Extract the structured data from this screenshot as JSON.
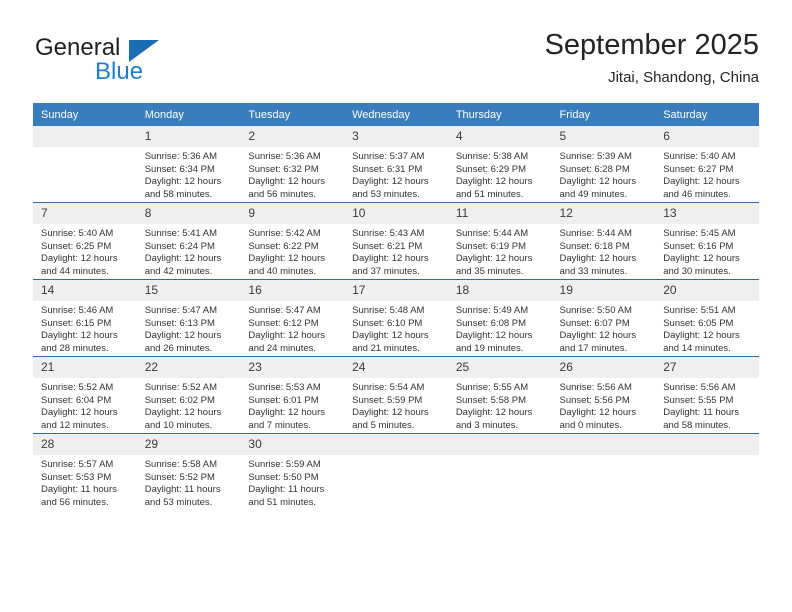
{
  "brand": {
    "name_top": "General",
    "name_bottom": "Blue",
    "triangle_icon": "triangle-icon",
    "color_black": "#231f20",
    "color_blue": "#1b7fd4"
  },
  "header": {
    "title": "September 2025",
    "subtitle": "Jitai, Shandong, China"
  },
  "theme": {
    "header_bg": "#3a7dbf",
    "row_divider": "#2e6da4",
    "daynum_bg": "#efefef",
    "text": "#333333"
  },
  "weekdays": [
    "Sunday",
    "Monday",
    "Tuesday",
    "Wednesday",
    "Thursday",
    "Friday",
    "Saturday"
  ],
  "labels": {
    "sunrise": "Sunrise:",
    "sunset": "Sunset:",
    "daylight": "Daylight:"
  },
  "weeks": [
    [
      {
        "day": "",
        "sunrise": "",
        "sunset": "",
        "daylight_line1": "",
        "daylight_line2": ""
      },
      {
        "day": "1",
        "sunrise": "Sunrise: 5:36 AM",
        "sunset": "Sunset: 6:34 PM",
        "daylight_line1": "Daylight: 12 hours",
        "daylight_line2": "and 58 minutes."
      },
      {
        "day": "2",
        "sunrise": "Sunrise: 5:36 AM",
        "sunset": "Sunset: 6:32 PM",
        "daylight_line1": "Daylight: 12 hours",
        "daylight_line2": "and 56 minutes."
      },
      {
        "day": "3",
        "sunrise": "Sunrise: 5:37 AM",
        "sunset": "Sunset: 6:31 PM",
        "daylight_line1": "Daylight: 12 hours",
        "daylight_line2": "and 53 minutes."
      },
      {
        "day": "4",
        "sunrise": "Sunrise: 5:38 AM",
        "sunset": "Sunset: 6:29 PM",
        "daylight_line1": "Daylight: 12 hours",
        "daylight_line2": "and 51 minutes."
      },
      {
        "day": "5",
        "sunrise": "Sunrise: 5:39 AM",
        "sunset": "Sunset: 6:28 PM",
        "daylight_line1": "Daylight: 12 hours",
        "daylight_line2": "and 49 minutes."
      },
      {
        "day": "6",
        "sunrise": "Sunrise: 5:40 AM",
        "sunset": "Sunset: 6:27 PM",
        "daylight_line1": "Daylight: 12 hours",
        "daylight_line2": "and 46 minutes."
      }
    ],
    [
      {
        "day": "7",
        "sunrise": "Sunrise: 5:40 AM",
        "sunset": "Sunset: 6:25 PM",
        "daylight_line1": "Daylight: 12 hours",
        "daylight_line2": "and 44 minutes."
      },
      {
        "day": "8",
        "sunrise": "Sunrise: 5:41 AM",
        "sunset": "Sunset: 6:24 PM",
        "daylight_line1": "Daylight: 12 hours",
        "daylight_line2": "and 42 minutes."
      },
      {
        "day": "9",
        "sunrise": "Sunrise: 5:42 AM",
        "sunset": "Sunset: 6:22 PM",
        "daylight_line1": "Daylight: 12 hours",
        "daylight_line2": "and 40 minutes."
      },
      {
        "day": "10",
        "sunrise": "Sunrise: 5:43 AM",
        "sunset": "Sunset: 6:21 PM",
        "daylight_line1": "Daylight: 12 hours",
        "daylight_line2": "and 37 minutes."
      },
      {
        "day": "11",
        "sunrise": "Sunrise: 5:44 AM",
        "sunset": "Sunset: 6:19 PM",
        "daylight_line1": "Daylight: 12 hours",
        "daylight_line2": "and 35 minutes."
      },
      {
        "day": "12",
        "sunrise": "Sunrise: 5:44 AM",
        "sunset": "Sunset: 6:18 PM",
        "daylight_line1": "Daylight: 12 hours",
        "daylight_line2": "and 33 minutes."
      },
      {
        "day": "13",
        "sunrise": "Sunrise: 5:45 AM",
        "sunset": "Sunset: 6:16 PM",
        "daylight_line1": "Daylight: 12 hours",
        "daylight_line2": "and 30 minutes."
      }
    ],
    [
      {
        "day": "14",
        "sunrise": "Sunrise: 5:46 AM",
        "sunset": "Sunset: 6:15 PM",
        "daylight_line1": "Daylight: 12 hours",
        "daylight_line2": "and 28 minutes."
      },
      {
        "day": "15",
        "sunrise": "Sunrise: 5:47 AM",
        "sunset": "Sunset: 6:13 PM",
        "daylight_line1": "Daylight: 12 hours",
        "daylight_line2": "and 26 minutes."
      },
      {
        "day": "16",
        "sunrise": "Sunrise: 5:47 AM",
        "sunset": "Sunset: 6:12 PM",
        "daylight_line1": "Daylight: 12 hours",
        "daylight_line2": "and 24 minutes."
      },
      {
        "day": "17",
        "sunrise": "Sunrise: 5:48 AM",
        "sunset": "Sunset: 6:10 PM",
        "daylight_line1": "Daylight: 12 hours",
        "daylight_line2": "and 21 minutes."
      },
      {
        "day": "18",
        "sunrise": "Sunrise: 5:49 AM",
        "sunset": "Sunset: 6:08 PM",
        "daylight_line1": "Daylight: 12 hours",
        "daylight_line2": "and 19 minutes."
      },
      {
        "day": "19",
        "sunrise": "Sunrise: 5:50 AM",
        "sunset": "Sunset: 6:07 PM",
        "daylight_line1": "Daylight: 12 hours",
        "daylight_line2": "and 17 minutes."
      },
      {
        "day": "20",
        "sunrise": "Sunrise: 5:51 AM",
        "sunset": "Sunset: 6:05 PM",
        "daylight_line1": "Daylight: 12 hours",
        "daylight_line2": "and 14 minutes."
      }
    ],
    [
      {
        "day": "21",
        "sunrise": "Sunrise: 5:52 AM",
        "sunset": "Sunset: 6:04 PM",
        "daylight_line1": "Daylight: 12 hours",
        "daylight_line2": "and 12 minutes."
      },
      {
        "day": "22",
        "sunrise": "Sunrise: 5:52 AM",
        "sunset": "Sunset: 6:02 PM",
        "daylight_line1": "Daylight: 12 hours",
        "daylight_line2": "and 10 minutes."
      },
      {
        "day": "23",
        "sunrise": "Sunrise: 5:53 AM",
        "sunset": "Sunset: 6:01 PM",
        "daylight_line1": "Daylight: 12 hours",
        "daylight_line2": "and 7 minutes."
      },
      {
        "day": "24",
        "sunrise": "Sunrise: 5:54 AM",
        "sunset": "Sunset: 5:59 PM",
        "daylight_line1": "Daylight: 12 hours",
        "daylight_line2": "and 5 minutes."
      },
      {
        "day": "25",
        "sunrise": "Sunrise: 5:55 AM",
        "sunset": "Sunset: 5:58 PM",
        "daylight_line1": "Daylight: 12 hours",
        "daylight_line2": "and 3 minutes."
      },
      {
        "day": "26",
        "sunrise": "Sunrise: 5:56 AM",
        "sunset": "Sunset: 5:56 PM",
        "daylight_line1": "Daylight: 12 hours",
        "daylight_line2": "and 0 minutes."
      },
      {
        "day": "27",
        "sunrise": "Sunrise: 5:56 AM",
        "sunset": "Sunset: 5:55 PM",
        "daylight_line1": "Daylight: 11 hours",
        "daylight_line2": "and 58 minutes."
      }
    ],
    [
      {
        "day": "28",
        "sunrise": "Sunrise: 5:57 AM",
        "sunset": "Sunset: 5:53 PM",
        "daylight_line1": "Daylight: 11 hours",
        "daylight_line2": "and 56 minutes."
      },
      {
        "day": "29",
        "sunrise": "Sunrise: 5:58 AM",
        "sunset": "Sunset: 5:52 PM",
        "daylight_line1": "Daylight: 11 hours",
        "daylight_line2": "and 53 minutes."
      },
      {
        "day": "30",
        "sunrise": "Sunrise: 5:59 AM",
        "sunset": "Sunset: 5:50 PM",
        "daylight_line1": "Daylight: 11 hours",
        "daylight_line2": "and 51 minutes."
      },
      {
        "day": "",
        "sunrise": "",
        "sunset": "",
        "daylight_line1": "",
        "daylight_line2": ""
      },
      {
        "day": "",
        "sunrise": "",
        "sunset": "",
        "daylight_line1": "",
        "daylight_line2": ""
      },
      {
        "day": "",
        "sunrise": "",
        "sunset": "",
        "daylight_line1": "",
        "daylight_line2": ""
      },
      {
        "day": "",
        "sunrise": "",
        "sunset": "",
        "daylight_line1": "",
        "daylight_line2": ""
      }
    ]
  ]
}
